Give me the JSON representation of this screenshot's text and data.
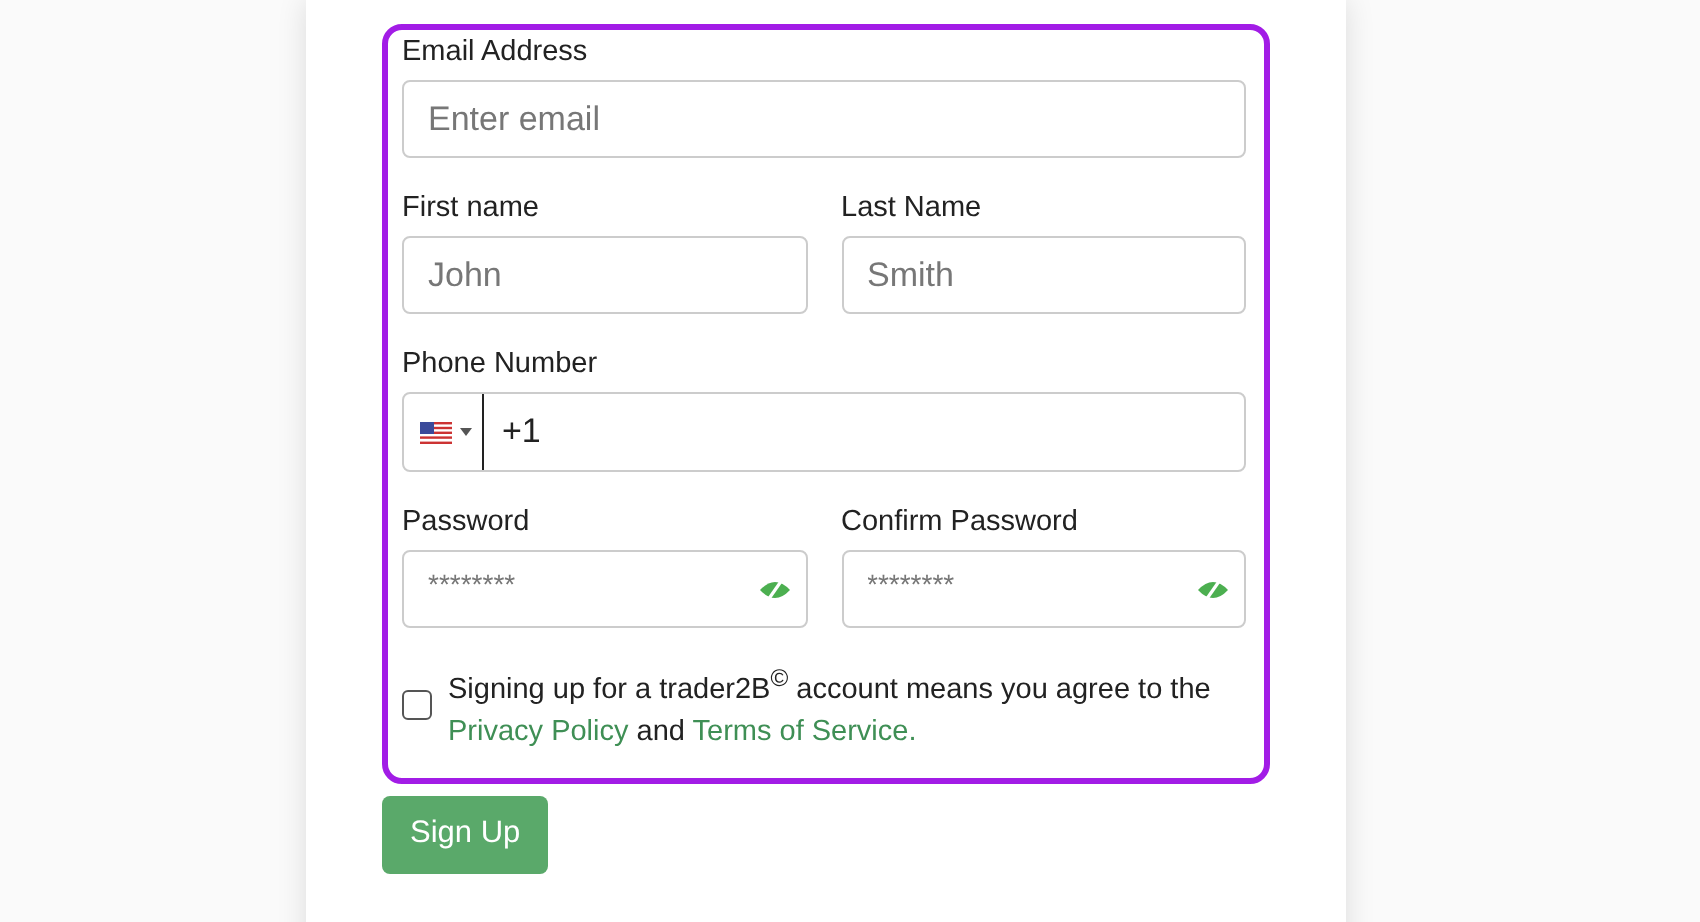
{
  "form": {
    "email": {
      "label": "Email Address",
      "placeholder": "Enter email"
    },
    "first_name": {
      "label": "First name",
      "placeholder": "John"
    },
    "last_name": {
      "label": "Last Name",
      "placeholder": "Smith"
    },
    "phone": {
      "label": "Phone Number",
      "value": "+1"
    },
    "password": {
      "label": "Password",
      "placeholder": "********"
    },
    "confirm_password": {
      "label": "Confirm Password",
      "placeholder": "********"
    },
    "agreement": {
      "checked": false,
      "text": "Signing up for a trader2B$^{©}$ account means you agree to the ",
      "privacy_link": "Privacy Policy",
      "middle": " and ",
      "terms_link": "Terms of Service."
    },
    "submit": "Sign Up"
  }
}
